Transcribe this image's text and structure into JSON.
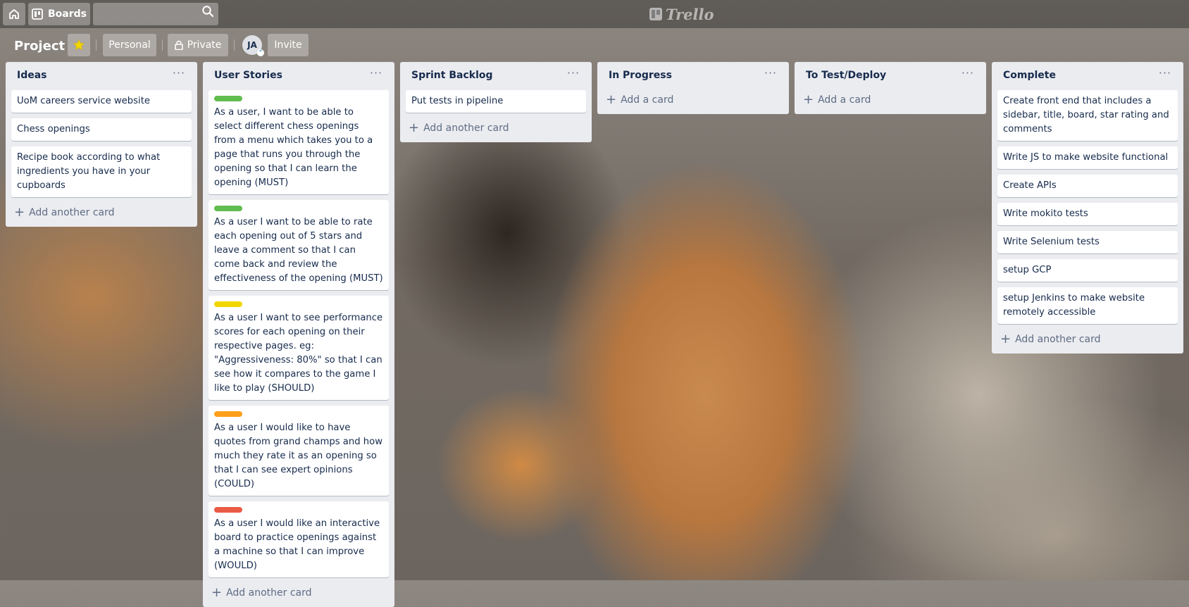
{
  "topbar": {
    "boards_label": "Boards",
    "search_placeholder": "",
    "logo_text": "Trello"
  },
  "board": {
    "title": "Project",
    "personal_label": "Personal",
    "private_label": "Private",
    "avatar_initials": "JA",
    "invite_label": "Invite"
  },
  "colors": {
    "label_green": "#61bd4f",
    "label_yellow": "#f2d600",
    "label_orange": "#ff9f1a",
    "label_red": "#eb5a46",
    "list_bg": "#ebecf0",
    "star": "#f2d600"
  },
  "lists": [
    {
      "name": "Ideas",
      "cards": [
        {
          "text": "UoM careers service website"
        },
        {
          "text": "Chess openings"
        },
        {
          "text": "Recipe book according to what ingredients you have in your cupboards"
        }
      ],
      "add_label": "Add another card"
    },
    {
      "name": "User Stories",
      "cards": [
        {
          "label": "green",
          "text": "As a user, I want to be able to select different chess openings from a menu which takes you to a page that runs you through the opening so that I can learn the opening (MUST)"
        },
        {
          "label": "green",
          "text": "As a user I want to be able to rate each opening out of 5 stars and leave a comment so that I can come back and review the effectiveness of the opening (MUST)"
        },
        {
          "label": "yellow",
          "text": "As a user I want to see performance scores for each opening on their respective pages. eg: \"Aggressiveness: 80%\" so that I can see how it compares to the game I like to play (SHOULD)"
        },
        {
          "label": "orange",
          "text": "As a user I would like to have quotes from grand champs and how much they rate it as an opening so that I can see expert opinions (COULD)"
        },
        {
          "label": "red",
          "text": "As a user I would like an interactive board to practice openings against a machine so that I can improve (WOULD)"
        }
      ],
      "add_label": "Add another card"
    },
    {
      "name": "Sprint Backlog",
      "cards": [
        {
          "text": "Put tests in pipeline"
        }
      ],
      "add_label": "Add another card"
    },
    {
      "name": "In Progress",
      "cards": [],
      "add_label": "Add a card"
    },
    {
      "name": "To Test/Deploy",
      "cards": [],
      "add_label": "Add a card"
    },
    {
      "name": "Complete",
      "cards": [
        {
          "text": "Create front end that includes a sidebar, title, board, star rating and comments"
        },
        {
          "text": "Write JS to make website functional"
        },
        {
          "text": "Create APIs"
        },
        {
          "text": "Write mokito tests"
        },
        {
          "text": "Write Selenium tests"
        },
        {
          "text": "setup GCP"
        },
        {
          "text": "setup Jenkins to make website remotely accessible"
        }
      ],
      "add_label": "Add another card"
    }
  ]
}
